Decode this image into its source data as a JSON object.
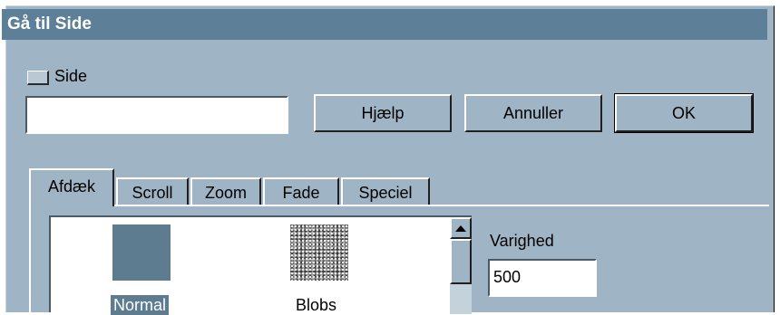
{
  "window": {
    "title": "Gå til Side"
  },
  "page_option": {
    "checkbox_label": "Side",
    "input_value": ""
  },
  "buttons": {
    "help": "Hjælp",
    "cancel": "Annuller",
    "ok": "OK"
  },
  "tabs": [
    {
      "label": "Afdæk",
      "active": true
    },
    {
      "label": "Scroll",
      "active": false
    },
    {
      "label": "Zoom",
      "active": false
    },
    {
      "label": "Fade",
      "active": false
    },
    {
      "label": "Speciel",
      "active": false
    }
  ],
  "effects": [
    {
      "label": "Normal",
      "selected": true,
      "icon": "solid-swatch"
    },
    {
      "label": "Blobs",
      "selected": false,
      "icon": "noise-swatch"
    }
  ],
  "duration": {
    "label": "Varighed",
    "value": "500"
  },
  "colors": {
    "titlebar": "#5d7f98",
    "face": "#9fb4c4",
    "selection": "#5e7c8f"
  }
}
